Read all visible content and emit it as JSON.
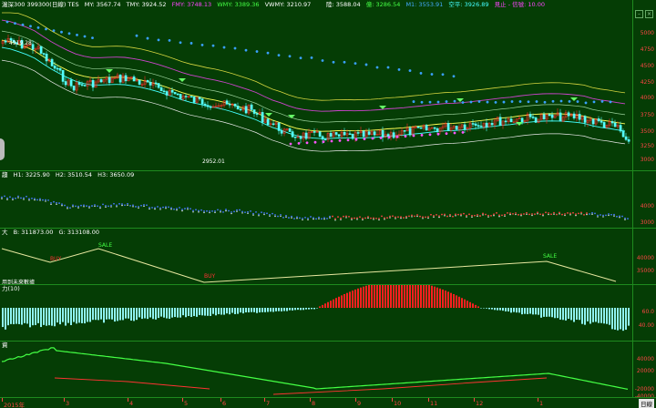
{
  "header": {
    "index_name": "滬深300 399300(日線) TES",
    "ma": [
      {
        "label": "MY: 3567.74",
        "color": "#ffffff"
      },
      {
        "label": "TMY: 3924.52",
        "color": "#ffffff"
      },
      {
        "label": "FMY: 3748.13",
        "color": "#ff44ff"
      },
      {
        "label": "WMY: 3389.36",
        "color": "#44ff44"
      },
      {
        "label": "VWMY: 3210.97",
        "color": "#ffffff"
      }
    ],
    "right": [
      {
        "label": "陸: 3588.04",
        "color": "#ffffff"
      },
      {
        "label": "億: 3286.54",
        "color": "#44ff44"
      },
      {
        "label": "M1: 3553.91",
        "color": "#44aaff"
      },
      {
        "label": "空平: 3926.89",
        "color": "#44ffff"
      },
      {
        "label": "見止 - 信號: 10.00",
        "color": "#ff44ff"
      }
    ]
  },
  "price_ticks": [
    "5000",
    "4750",
    "4500",
    "4250",
    "4000",
    "3750",
    "3500",
    "3250",
    "3000"
  ],
  "price_notes": {
    "high": "4919.28",
    "low": "2952.01"
  },
  "colors": {
    "bg": "#053d05",
    "up": "#ff2a2a",
    "down": "#55ffff",
    "grid": "#1e8a1e",
    "axis": "#ff4545"
  },
  "panel2": {
    "header": [
      {
        "label": "趨",
        "color": "#ffffff"
      },
      {
        "label": "H1: 3225.90",
        "color": "#ffffff"
      },
      {
        "label": "H2: 3510.54",
        "color": "#ffffff"
      },
      {
        "label": "H3: 3650.09",
        "color": "#ffffff"
      }
    ],
    "ticks": [
      "4000",
      "3000"
    ]
  },
  "panel3": {
    "header": [
      {
        "label": "大",
        "color": "#ffffff"
      },
      {
        "label": "B: 311873.00",
        "color": "#ffffff"
      },
      {
        "label": "G: 313108.00",
        "color": "#ffffff"
      }
    ],
    "ticks": [
      "40000",
      "35000"
    ],
    "markers": [
      "SALE",
      "BUY",
      "BUY",
      "SALE"
    ],
    "note": "用到未來數據"
  },
  "panel4": {
    "header": [
      {
        "label": "力(10)",
        "color": "#ffffff"
      }
    ],
    "ticks": [
      "60.0",
      "40.00"
    ]
  },
  "panel5": {
    "header": [
      {
        "label": "資",
        "color": "#ffffff"
      }
    ],
    "ticks": [
      "40000",
      "20000",
      "-20000",
      "-40000"
    ]
  },
  "timebar": {
    "labels": [
      "2015年",
      "3",
      "4",
      "5",
      "6",
      "7",
      "8",
      "9",
      "10",
      "11",
      "12",
      "1"
    ],
    "dayview": "日線"
  }
}
